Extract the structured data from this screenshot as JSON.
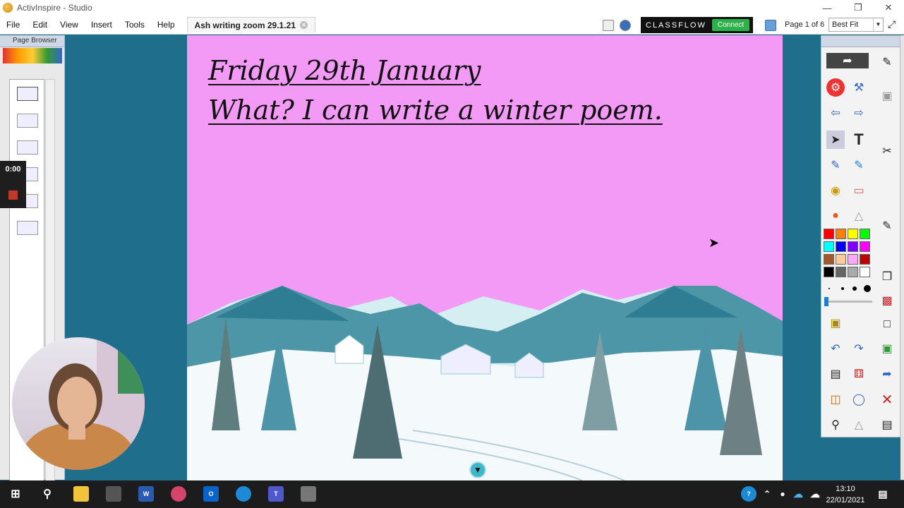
{
  "window": {
    "title": "ActivInspire - Studio"
  },
  "menu": [
    "File",
    "Edit",
    "View",
    "Insert",
    "Tools",
    "Help"
  ],
  "document_tab": {
    "label": "Ash writing zoom 29.1.21"
  },
  "classflow": {
    "brand": "CLASSFLOW",
    "connect_label": "Connect"
  },
  "page_indicator": "Page 1 of 6",
  "zoom": {
    "selected": "Best Fit"
  },
  "page_browser": {
    "title": "Page Browser",
    "thumbnail_count": 6
  },
  "recorder": {
    "time": "0:00"
  },
  "canvas": {
    "line1": "Friday 29th January",
    "line2": "What? I can write a winter poem.",
    "background": "#f39af7"
  },
  "toolbox": {
    "colors": [
      "#ff0000",
      "#ff8000",
      "#ffff00",
      "#00ff00",
      "#00ffff",
      "#0000ff",
      "#8000ff",
      "#ff00ff",
      "#a05a2c",
      "#ffcc99",
      "#ffaaff",
      "#c00000",
      "#000000",
      "#666666",
      "#aaaaaa",
      "#ffffff"
    ]
  },
  "taskbar": {
    "time": "13:10",
    "date": "22/01/2021"
  }
}
